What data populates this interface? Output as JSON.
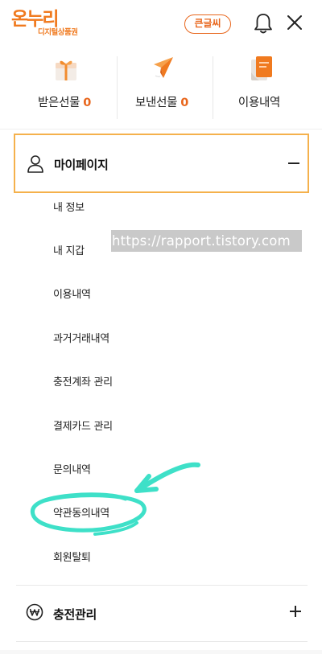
{
  "header": {
    "logo_main": "온누리",
    "logo_sub": "디지털상품권",
    "bigfont_label": "큰글씨",
    "brand_color": "#e8661c"
  },
  "gifts": [
    {
      "label": "받은선물",
      "count": "0"
    },
    {
      "label": "보낸선물",
      "count": "0"
    },
    {
      "label": "이용내역",
      "count": ""
    }
  ],
  "menu": {
    "mypage": {
      "label": "마이페이지",
      "items": [
        "내 정보",
        "내 지갑",
        "이용내역",
        "과거거래내역",
        "충전계좌 관리",
        "결제카드 관리",
        "문의내역",
        "약관동의내역",
        "회원탈퇴"
      ]
    },
    "charge": {
      "label": "충전관리"
    }
  },
  "watermark": "https://rapport.tistory.com",
  "annotation_color": "#3ee0c8"
}
